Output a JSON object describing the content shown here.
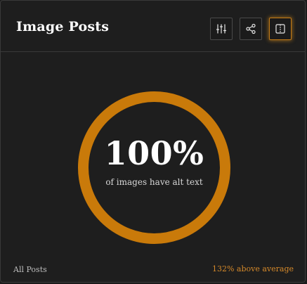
{
  "header": {
    "title": "Image Posts"
  },
  "toolbar": {
    "filter_icon": "sliders-icon",
    "share_icon": "share-icon",
    "split_icon": "split-view-icon"
  },
  "metric": {
    "percent_text": "100%",
    "percent_value": 100,
    "caption": "of images have alt text"
  },
  "footer": {
    "left": "All Posts",
    "right": "132% above average"
  },
  "colors": {
    "accent": "#c97a0a",
    "active_glow": "#e8961e",
    "comparison_text": "#d5892a",
    "background": "#1e1e1e"
  }
}
